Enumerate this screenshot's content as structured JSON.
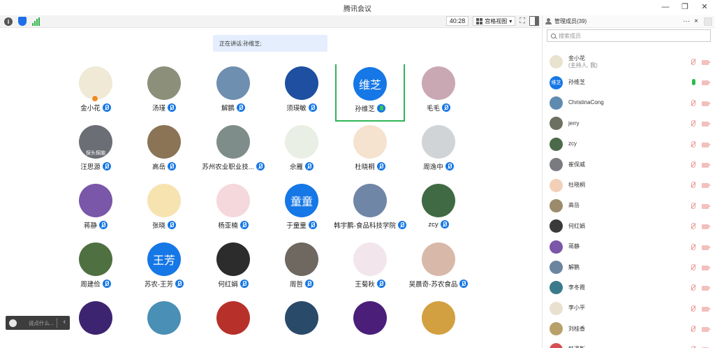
{
  "window": {
    "title": "腾讯会议"
  },
  "toolbar": {
    "timer": "40:28",
    "view_mode": "宫格视图"
  },
  "banner": {
    "prefix": "正在讲话: ",
    "speaker": "孙维芝;"
  },
  "panel": {
    "header": "管理成员(39)",
    "more": "···",
    "close": "×",
    "search_placeholder": "搜索成员"
  },
  "members": [
    {
      "name": "金小花",
      "sub": "(主持人, 我)",
      "mic": "off",
      "color": "#e8e2cf"
    },
    {
      "name": "孙维芝",
      "sub": "",
      "mic": "on",
      "color": "#1677e6",
      "text": "维芝"
    },
    {
      "name": "ChristinaCong",
      "sub": "",
      "mic": "off",
      "color": "#5f8bb0"
    },
    {
      "name": "jerry",
      "sub": "",
      "mic": "off",
      "color": "#6c7061"
    },
    {
      "name": "zcy",
      "sub": "",
      "mic": "off",
      "color": "#4b6a49"
    },
    {
      "name": "崔保威",
      "sub": "",
      "mic": "off",
      "color": "#7a7b80"
    },
    {
      "name": "杜晓桐",
      "sub": "",
      "mic": "off",
      "color": "#f2d0b8"
    },
    {
      "name": "高岳",
      "sub": "",
      "mic": "off",
      "color": "#9b8a6b"
    },
    {
      "name": "何红娟",
      "sub": "",
      "mic": "off",
      "color": "#3a3a3a"
    },
    {
      "name": "蒋静",
      "sub": "",
      "mic": "off",
      "color": "#7a57a8"
    },
    {
      "name": "解鹏",
      "sub": "",
      "mic": "off",
      "color": "#6b84a0"
    },
    {
      "name": "李冬霞",
      "sub": "",
      "mic": "off",
      "color": "#3b7a8a"
    },
    {
      "name": "李小平",
      "sub": "",
      "mic": "off",
      "color": "#e9e0d0"
    },
    {
      "name": "刘桂香",
      "sub": "",
      "mic": "off",
      "color": "#b8a06a"
    },
    {
      "name": "韩潇斯",
      "sub": "",
      "mic": "off",
      "color": "#d65050"
    }
  ],
  "participants": [
    {
      "name": "金小花",
      "color": "#efe9d6",
      "host": true
    },
    {
      "name": "汤瑾",
      "color": "#8c8f7a"
    },
    {
      "name": "解鹏",
      "color": "#6f8fb0"
    },
    {
      "name": "须瑛敏",
      "color": "#1e4fa0"
    },
    {
      "name": "孙维芝",
      "color": "#1677e6",
      "text": "维芝",
      "active": true
    },
    {
      "name": "毛毛",
      "color": "#c9a7b3"
    },
    {
      "name": "汪思源",
      "color": "#6b6e75",
      "caption": "探头探脑"
    },
    {
      "name": "高岳",
      "color": "#8a7455"
    },
    {
      "name": "苏州农业职业技...",
      "color": "#7f8d8a"
    },
    {
      "name": "佘雁",
      "color": "#e9efe4"
    },
    {
      "name": "杜晓桐",
      "color": "#f5e2cf"
    },
    {
      "name": "周逸中",
      "color": "#d0d4d6"
    },
    {
      "name": "蒋静",
      "color": "#7a57a8"
    },
    {
      "name": "张晓",
      "color": "#f6e3b0"
    },
    {
      "name": "杨亚楠",
      "color": "#f5d8dc"
    },
    {
      "name": "于童童",
      "color": "#1677e6",
      "text": "童童"
    },
    {
      "name": "韩宇鹏-食品科技学院",
      "color": "#6f86a6"
    },
    {
      "name": "zcy",
      "color": "#3f6a43"
    },
    {
      "name": "周建俭",
      "color": "#4f7040"
    },
    {
      "name": "苏农-王芳",
      "color": "#1677e6",
      "text": "王芳"
    },
    {
      "name": "何红娟",
      "color": "#2c2c2c"
    },
    {
      "name": "周哲",
      "color": "#6e6860"
    },
    {
      "name": "王菊秋",
      "color": "#f2e6ec"
    },
    {
      "name": "吴晨奇-苏农食品",
      "color": "#d8b8a8"
    },
    {
      "name": "",
      "color": "#3d2470"
    },
    {
      "name": "",
      "color": "#4a8fb5"
    },
    {
      "name": "",
      "color": "#b8302a"
    },
    {
      "name": "",
      "color": "#2a4a6a"
    },
    {
      "name": "",
      "color": "#4b1e7a"
    },
    {
      "name": "",
      "color": "#d2a040"
    }
  ],
  "chat": {
    "placeholder": "说点什么..."
  }
}
